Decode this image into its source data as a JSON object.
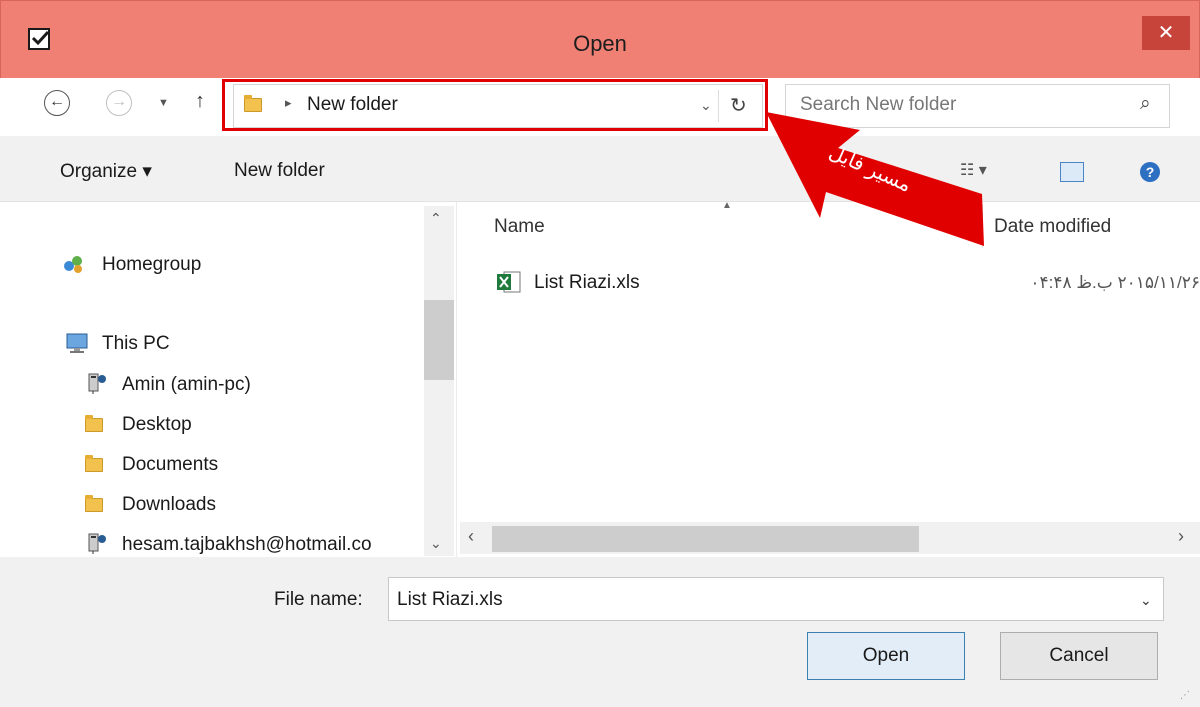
{
  "window": {
    "title": "Open"
  },
  "nav": {
    "back_glyph": "←",
    "forward_glyph": "→",
    "up_glyph": "↑"
  },
  "address": {
    "folder": "New folder",
    "separator": "▸"
  },
  "search": {
    "placeholder": "Search New folder"
  },
  "toolbar": {
    "organize": "Organize ▾",
    "new_folder": "New folder"
  },
  "sidebar": {
    "homegroup": "Homegroup",
    "this_pc": "This PC",
    "items": [
      "Amin (amin-pc)",
      "Desktop",
      "Documents",
      "Downloads",
      "hesam.tajbakhsh@hotmail.co"
    ]
  },
  "columns": {
    "name": "Name",
    "date_modified": "Date modified"
  },
  "files": [
    {
      "name": "List Riazi.xls",
      "date": "۲۰۱۵/۱۱/۲۶ ب.ظ ۰۴:۴۸"
    }
  ],
  "callout": {
    "text": "مسیر فایل"
  },
  "filename": {
    "label": "File name:",
    "value": "List Riazi.xls"
  },
  "buttons": {
    "open": "Open",
    "cancel": "Cancel"
  },
  "colors": {
    "frame": "#f08074",
    "highlight": "#e00000",
    "arrow": "#e00000"
  }
}
